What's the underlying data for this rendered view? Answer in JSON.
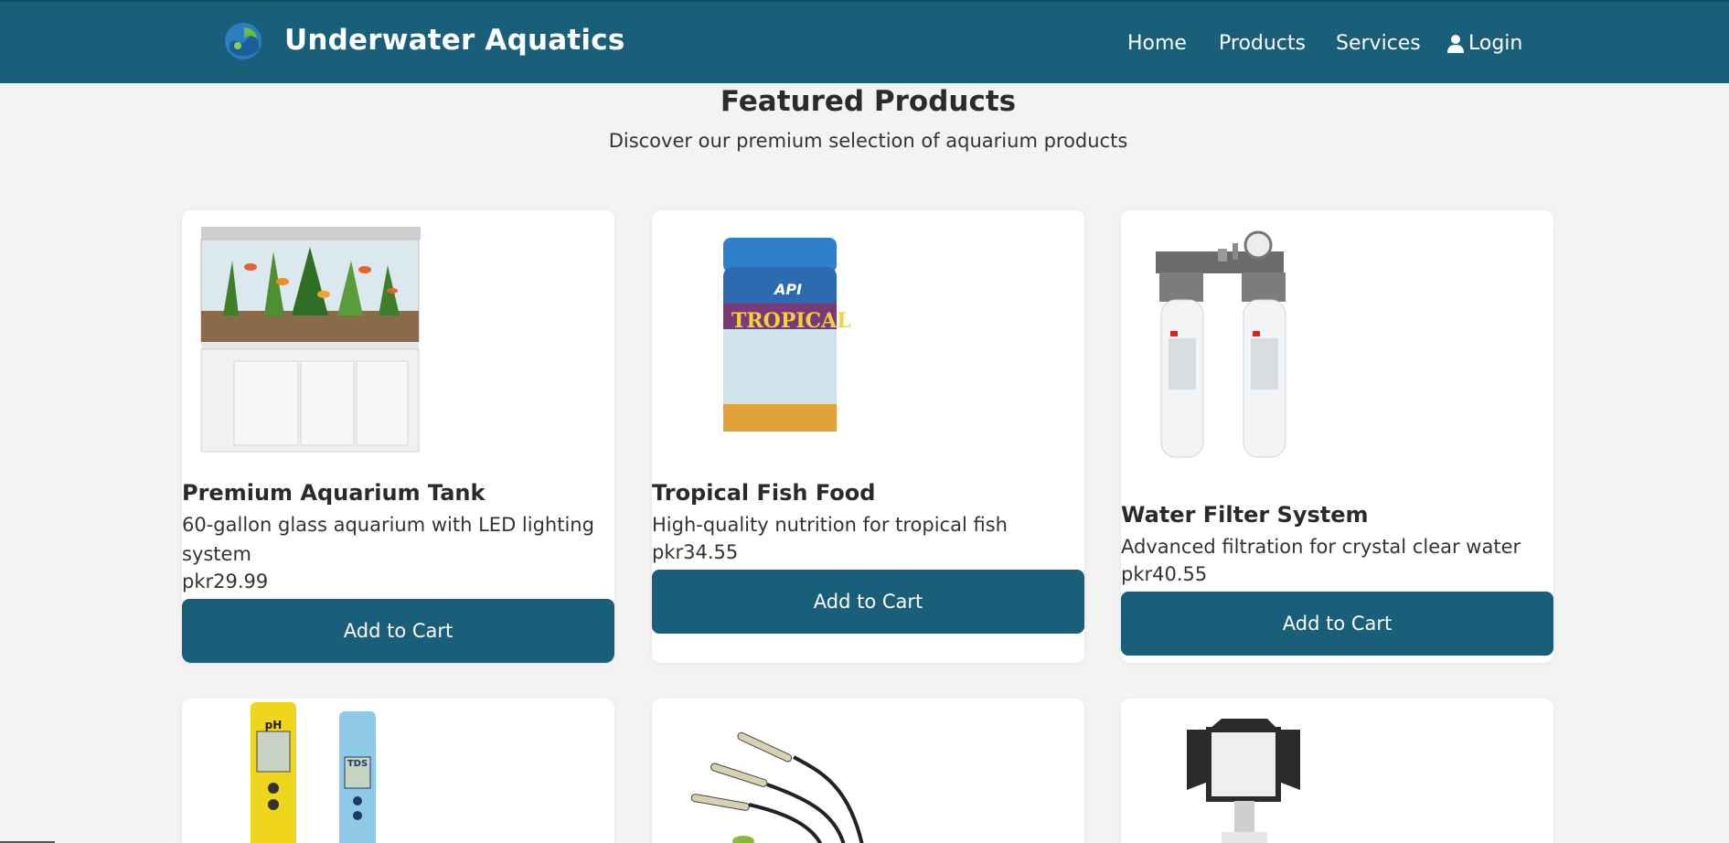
{
  "header": {
    "brand": "Underwater Aquatics",
    "nav": {
      "home": "Home",
      "products": "Products",
      "services": "Services",
      "login": "Login"
    }
  },
  "featured": {
    "title": "Featured Products",
    "subtitle": "Discover our premium selection of aquarium products"
  },
  "products": [
    {
      "name": "Premium Aquarium Tank",
      "description": "60-gallon glass aquarium with LED lighting system",
      "price": "pkr29.99",
      "button": "Add to Cart",
      "image": "aquarium-tank-image"
    },
    {
      "name": "Tropical Fish Food",
      "description": "High-quality nutrition for tropical fish",
      "price": "pkr34.55",
      "button": "Add to Cart",
      "image": "fish-food-jar-image",
      "image_text": {
        "brand": "API",
        "label": "TROPICAL"
      }
    },
    {
      "name": "Water Filter System",
      "description": "Advanced filtration for crystal clear water",
      "price": "pkr40.55",
      "button": "Add to Cart",
      "image": "water-filter-image"
    },
    {
      "image": "ph-tds-meter-image",
      "image_text": {
        "ph": "pH",
        "tds": "TDS"
      }
    },
    {
      "image": "aquarium-led-light-image"
    },
    {
      "image": "led-panel-light-image"
    }
  ],
  "colors": {
    "primary": "#1a5f7a",
    "background": "#f3f3f3",
    "card": "#ffffff"
  }
}
